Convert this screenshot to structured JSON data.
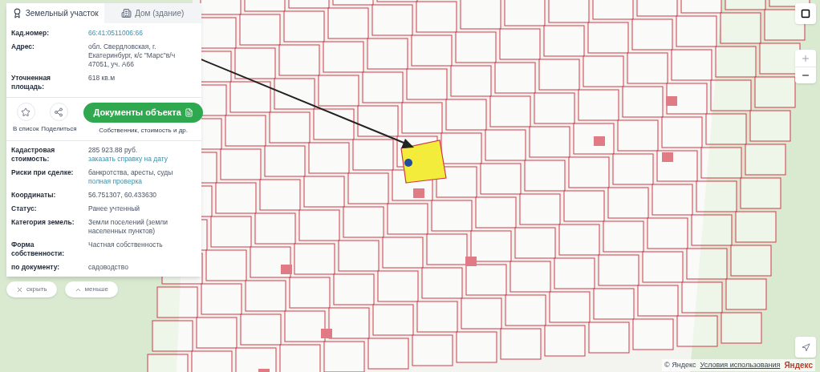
{
  "panel": {
    "tabs": [
      {
        "label": "Земельный участок",
        "selected": true,
        "kind": "parcel"
      },
      {
        "label": "Дом (здание)",
        "selected": false,
        "kind": "building"
      }
    ],
    "top_rows": [
      {
        "label": "Кад.номер:",
        "link": "66:41:0511006:66"
      },
      {
        "label": "Адрес:",
        "value": "обл. Свердловская, г. Екатеринбург, к/с \"Марс\"в/ч 47051, уч. А66"
      },
      {
        "label": "Уточненная площадь:",
        "value": "618 кв.м"
      }
    ],
    "actions": [
      {
        "label": "В список",
        "kind": "star"
      },
      {
        "label": "Поделиться",
        "kind": "share"
      }
    ],
    "documents_button": {
      "label": "Документы объекта",
      "caption": "Собственник, стоимость и др."
    },
    "rows": [
      {
        "label": "Кадастровая стоимость:",
        "value": "285 923.88 руб.",
        "link": "заказать справку на дату"
      },
      {
        "label": "Риски при сделке:",
        "value": "банкротства, аресты, суды",
        "link": "полная проверка"
      },
      {
        "label": "Координаты:",
        "value": "56.751307, 60.433630"
      },
      {
        "label": "Статус:",
        "value": "Ранее учтенный"
      },
      {
        "label": "Категория земель:",
        "value": "Земли поселений (земли населенных пунктов)"
      },
      {
        "label": "Форма собственности:",
        "value": "Частная собственность"
      },
      {
        "label": "по документу:",
        "value": "садоводство"
      }
    ]
  },
  "panel_buttons": [
    {
      "label": "скрыть",
      "kind": "close"
    },
    {
      "label": "меньше",
      "kind": "collapse"
    }
  ],
  "attribution": {
    "copyright": "© Яндекс",
    "terms_link": "Условия использования",
    "logo": "Яндекс"
  }
}
